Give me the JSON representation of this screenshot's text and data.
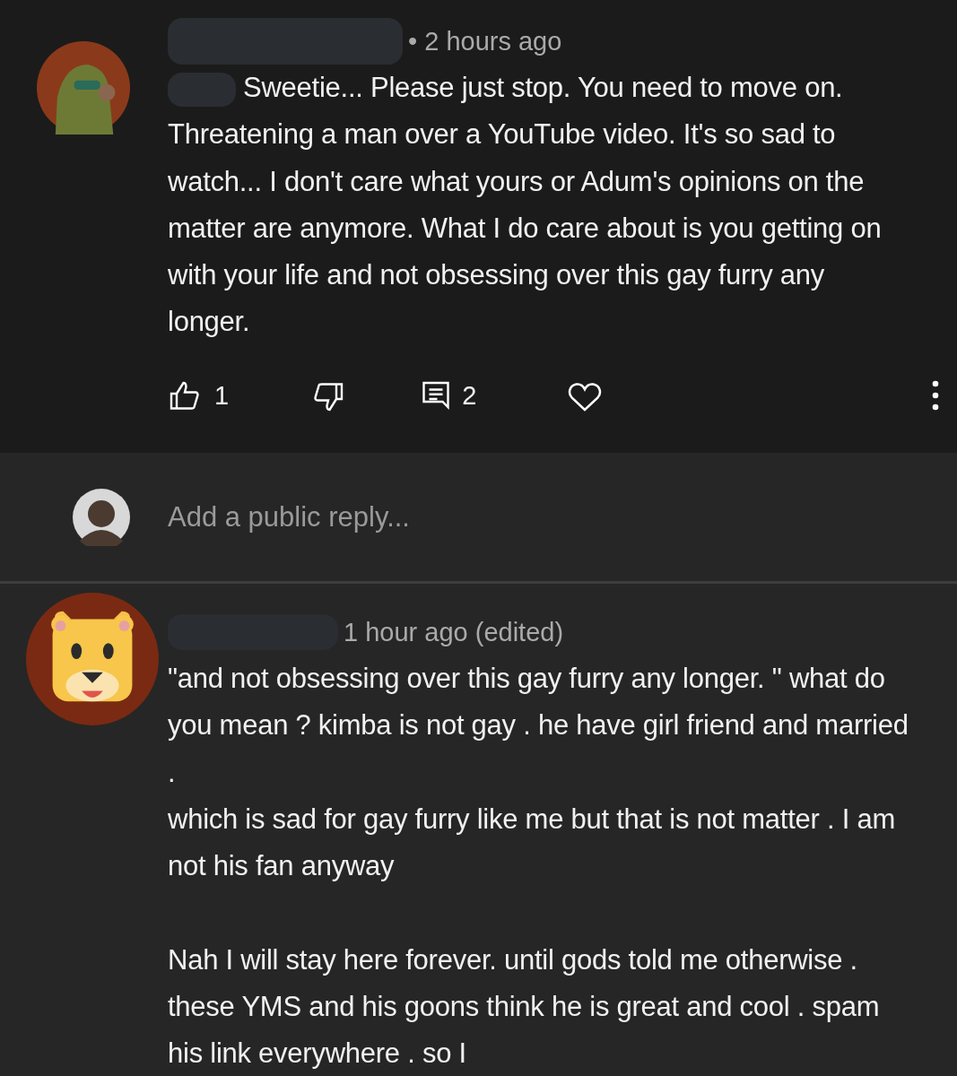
{
  "comments": [
    {
      "time": "• 2 hours ago",
      "text": "Sweetie... Please just stop. You need to move on. Threatening a man over a YouTube video. It's so sad to watch... I don't care what yours or Adum's opinions on the matter are anymore. What I do care about is you getting on with your life and not obsessing over this gay furry any longer.",
      "actions": {
        "likes": "1",
        "replies": "2",
        "liked": false,
        "hearted": false
      }
    },
    {
      "time": "1 hour ago (edited)",
      "text": "\"and not obsessing over this gay furry any longer. \" what do you mean ? kimba is not gay . he have girl friend and married .\nwhich is sad for gay furry like me but that is not matter . I am not his fan anyway\n\nNah I will stay here forever. until gods told me otherwise . these YMS and his goons think he is great and cool . spam his link everywhere . so I"
    }
  ],
  "reply_box": {
    "placeholder": "Add a public reply..."
  }
}
